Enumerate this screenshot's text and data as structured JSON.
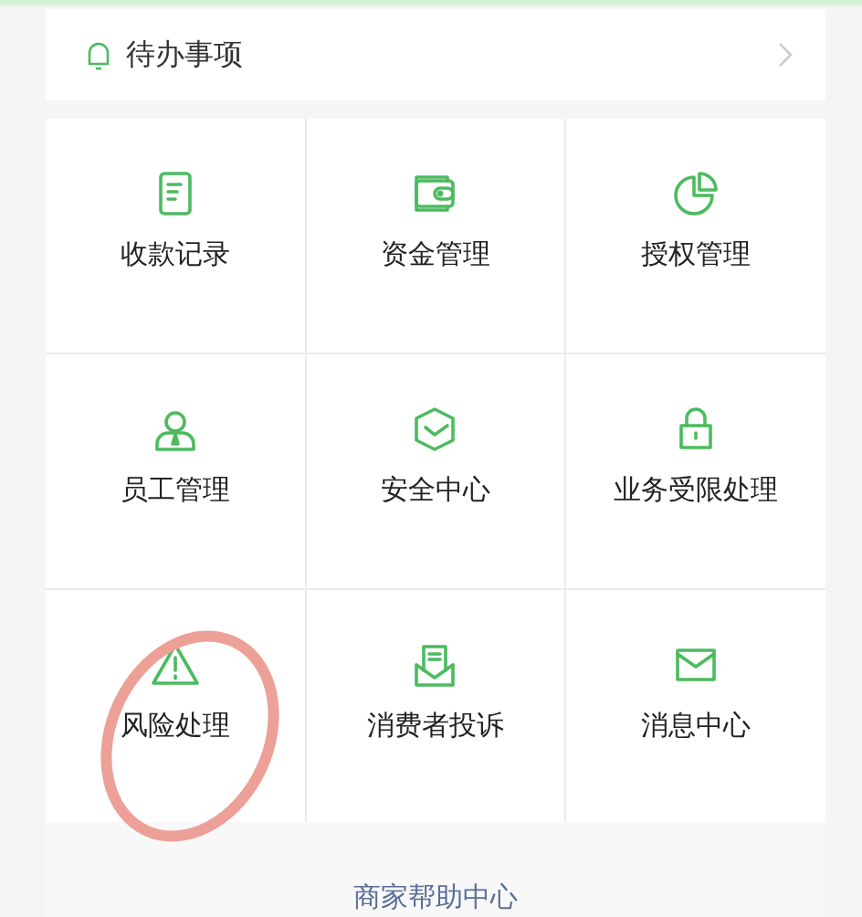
{
  "todo": {
    "label": "待办事项"
  },
  "services": [
    {
      "label": "收款记录",
      "circled": false
    },
    {
      "label": "资金管理",
      "circled": false
    },
    {
      "label": "授权管理",
      "circled": false
    },
    {
      "label": "员工管理",
      "circled": false
    },
    {
      "label": "安全中心",
      "circled": false
    },
    {
      "label": "业务受限处理",
      "circled": false
    },
    {
      "label": "风险处理",
      "circled": true
    },
    {
      "label": "消费者投诉",
      "circled": false
    },
    {
      "label": "消息中心",
      "circled": false
    }
  ],
  "help_link": "商家帮助中心"
}
